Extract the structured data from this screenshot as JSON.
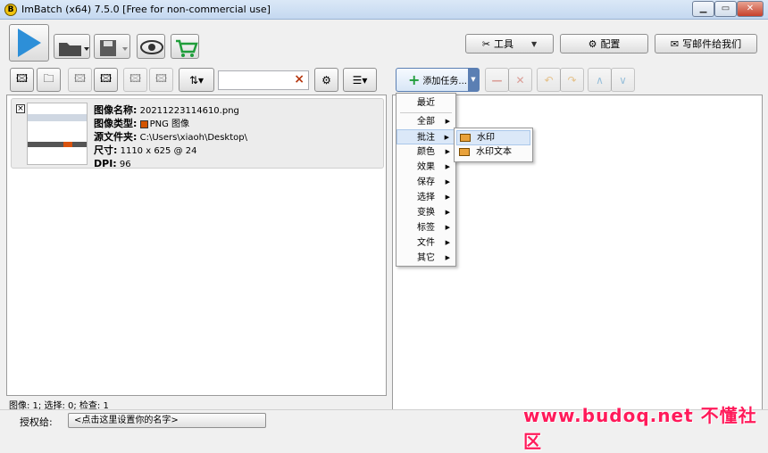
{
  "window": {
    "title": "ImBatch (x64) 7.5.0 [Free for non-commercial use]",
    "app_icon_letter": "B"
  },
  "toolbar": {
    "tools_label": "工具",
    "config_label": "配置",
    "email_label": "写邮件给我们"
  },
  "list_toolbar": {
    "filter_value": "",
    "clear_symbol": "×"
  },
  "task_toolbar": {
    "add_task_label": "添加任务..."
  },
  "image": {
    "name_label": "图像名称:",
    "name_value": "20211223114610.png",
    "type_label": "图像类型:",
    "type_value": "PNG 图像",
    "source_label": "源文件夹:",
    "source_value": "C:\\Users\\xiaoh\\Desktop\\",
    "size_label": "尺寸:",
    "size_value": "1110 x 625 @ 24",
    "dpi_label": "DPI:",
    "dpi_value": "96"
  },
  "add_task_menu": {
    "items": [
      "最近",
      "全部",
      "批注",
      "颜色",
      "效果",
      "保存",
      "选择",
      "变换",
      "标签",
      "文件",
      "其它"
    ],
    "highlighted": "批注"
  },
  "annotation_submenu": {
    "items": [
      "水印",
      "水印文本"
    ],
    "highlighted": "水印"
  },
  "status": {
    "left": "图像: 1; 选择: 0; 检查: 1"
  },
  "license": {
    "label": "授权给:",
    "value": "<点击这里设置你的名字>"
  },
  "watermark_text": "www.budoq.net 不懂社区",
  "colors": {
    "accent_blue": "#2d8fd8",
    "menu_highlight": "#dbe8f8",
    "watermark": "#ff1a5a"
  }
}
